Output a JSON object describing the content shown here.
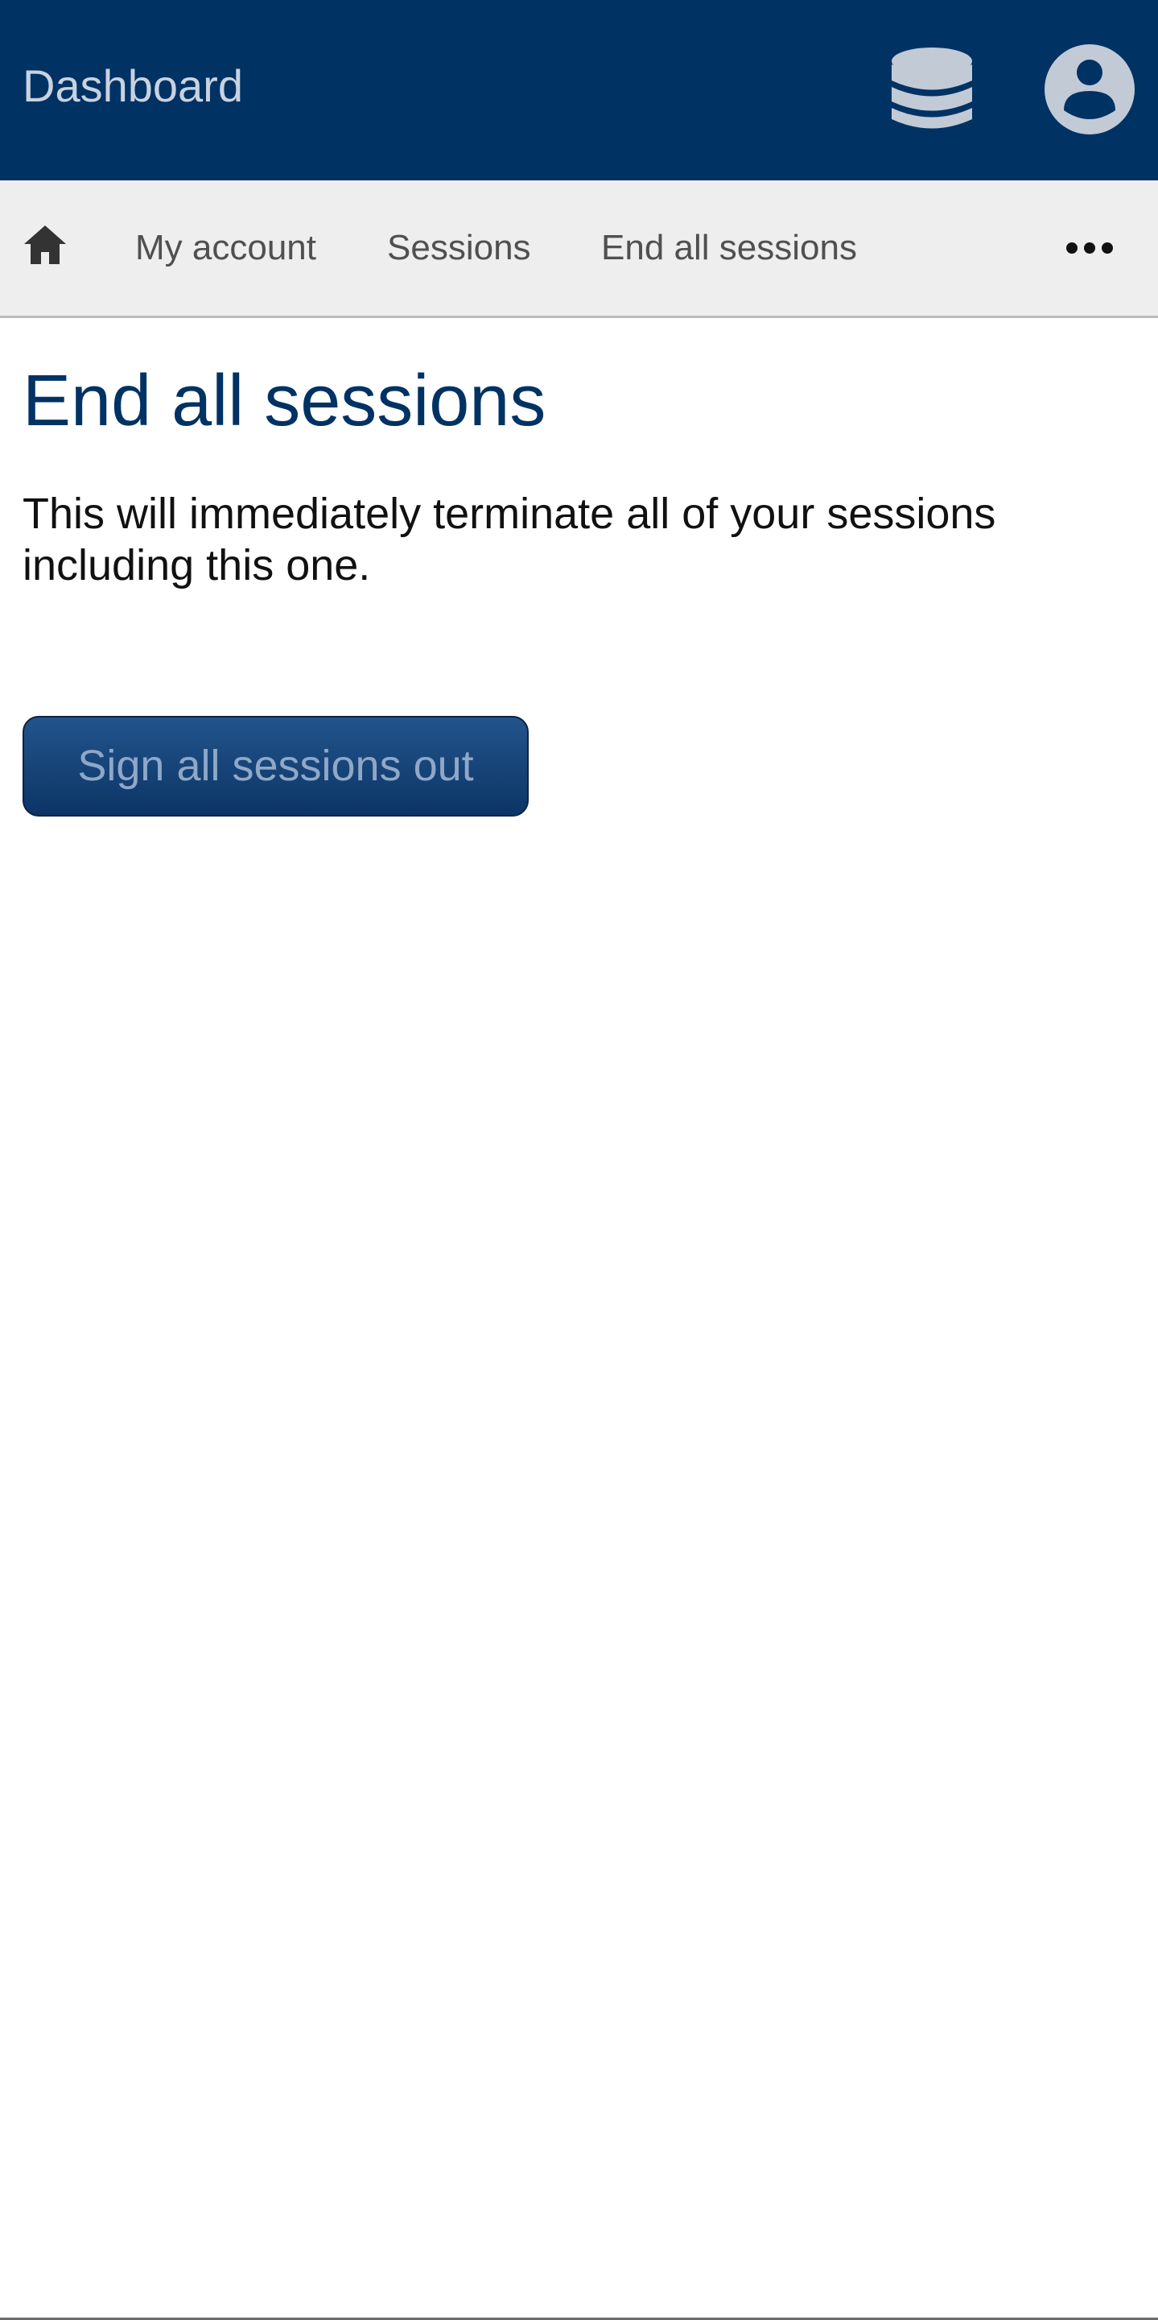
{
  "header": {
    "title": "Dashboard",
    "icons": [
      "database-icon",
      "user-account-icon"
    ]
  },
  "nav": {
    "home_icon": "home-icon",
    "items": [
      {
        "label": "My account"
      },
      {
        "label": "Sessions"
      },
      {
        "label": "End all sessions"
      }
    ],
    "more_icon": "more-horizontal-icon"
  },
  "main": {
    "title": "End all sessions",
    "description": "This will immediately terminate all of your sessions including this one.",
    "button_label": "Sign all sessions out"
  },
  "colors": {
    "header_bg": "#003264",
    "nav_bg": "#eeeeee",
    "title_color": "#003264",
    "button_bg": "#1a4a80",
    "button_text": "#8fa8c8"
  }
}
